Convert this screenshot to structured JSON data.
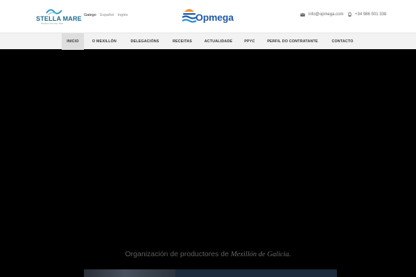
{
  "brand": {
    "partner_name": "STELLA MARE",
    "partner_tagline": "PRODUCTOS DEL MAR",
    "logo_name": "Opmega"
  },
  "languages": [
    {
      "label": "Galego",
      "active": true
    },
    {
      "label": "Español",
      "active": false
    },
    {
      "label": "Inglés",
      "active": false
    }
  ],
  "contact": {
    "email": "info@opmega.com",
    "phone": "+34 986 501 338",
    "email_icon": "envelope-icon",
    "phone_icon": "phone-icon"
  },
  "nav": {
    "items": [
      {
        "label": "INICIO",
        "active": true
      },
      {
        "label": "O MEXILLÓN"
      },
      {
        "label": "DELEGACIÓNS"
      },
      {
        "label": "RECEITAS"
      },
      {
        "label": "ACTUALIDADE"
      },
      {
        "label": "PPYC"
      },
      {
        "label": "PERFIL DO CONTRATANTE"
      },
      {
        "label": "CONTACTO"
      }
    ]
  },
  "hero": {
    "caption_prefix": "Organización de productores de ",
    "caption_emphasis": "Mexillón de Galicia",
    "caption_suffix": "."
  },
  "colors": {
    "nav_bg": "#f2f2f2",
    "nav_active": "#dedede",
    "brand_blue": "#1e5aa8",
    "accent_orange": "#f0962d",
    "hero_bg": "#000000"
  }
}
